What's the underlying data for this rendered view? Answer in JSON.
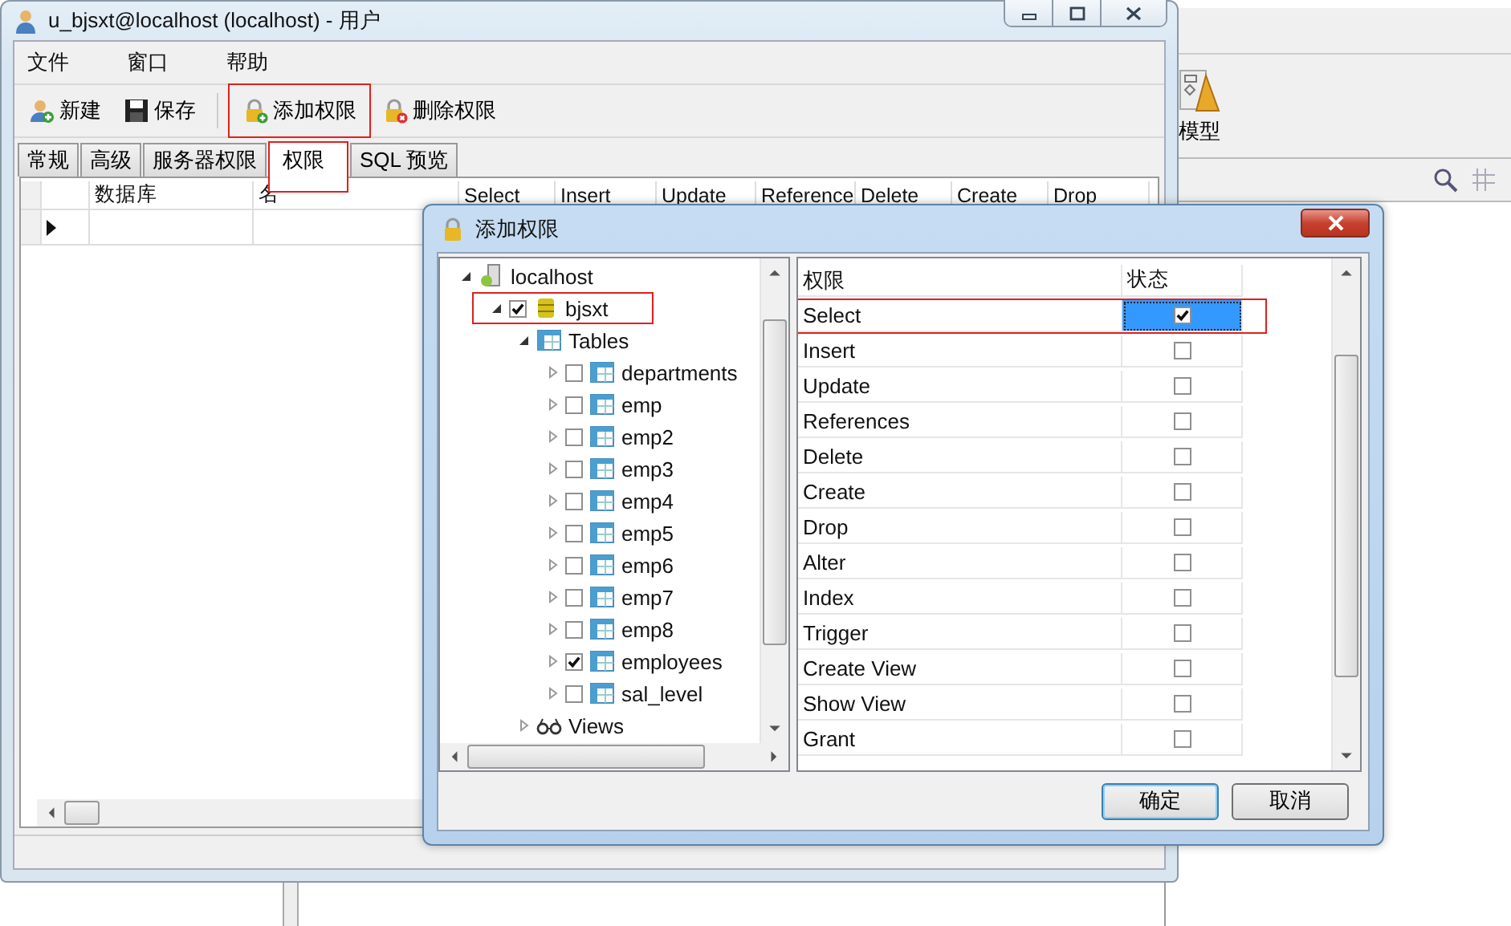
{
  "background_window": {
    "toolbar": [
      {
        "label": "模型",
        "kind": "model"
      }
    ]
  },
  "main_window": {
    "title": "u_bjsxt@localhost (localhost) - 用户",
    "menu": [
      "文件",
      "窗口",
      "帮助"
    ],
    "toolbar": [
      {
        "label": "新建",
        "kind": "new",
        "highlighted": false
      },
      {
        "label": "保存",
        "kind": "save",
        "highlighted": false
      },
      {
        "label": "添加权限",
        "kind": "add-lock",
        "highlighted": true
      },
      {
        "label": "删除权限",
        "kind": "remove-lock",
        "highlighted": false
      }
    ],
    "tabs": [
      {
        "label": "常规",
        "selected": false,
        "highlighted": false
      },
      {
        "label": "高级",
        "selected": false,
        "highlighted": false
      },
      {
        "label": "服务器权限",
        "selected": false,
        "highlighted": false
      },
      {
        "label": "权限",
        "selected": true,
        "highlighted": true
      },
      {
        "label": "SQL 预览",
        "selected": false,
        "highlighted": false
      }
    ],
    "grid": {
      "columns": [
        "数据库",
        "名",
        "Select",
        "Insert",
        "Update",
        "Reference",
        "Delete",
        "Create",
        "Drop"
      ],
      "rows": [
        {
          "current": true
        }
      ]
    }
  },
  "dialog": {
    "title": "添加权限",
    "tree": [
      {
        "label": "localhost",
        "kind": "server",
        "expanded": true,
        "children": [
          {
            "label": "bjsxt",
            "kind": "database",
            "expanded": true,
            "checked": true,
            "highlighted": true,
            "children": [
              {
                "label": "Tables",
                "kind": "folder",
                "expanded": true,
                "children": [
                  {
                    "label": "departments",
                    "kind": "table",
                    "expanded": false,
                    "checked": false
                  },
                  {
                    "label": "emp",
                    "kind": "table",
                    "expanded": false,
                    "checked": false
                  },
                  {
                    "label": "emp2",
                    "kind": "table",
                    "expanded": false,
                    "checked": false
                  },
                  {
                    "label": "emp3",
                    "kind": "table",
                    "expanded": false,
                    "checked": false
                  },
                  {
                    "label": "emp4",
                    "kind": "table",
                    "expanded": false,
                    "checked": false
                  },
                  {
                    "label": "emp5",
                    "kind": "table",
                    "expanded": false,
                    "checked": false
                  },
                  {
                    "label": "emp6",
                    "kind": "table",
                    "expanded": false,
                    "checked": false
                  },
                  {
                    "label": "emp7",
                    "kind": "table",
                    "expanded": false,
                    "checked": false
                  },
                  {
                    "label": "emp8",
                    "kind": "table",
                    "expanded": false,
                    "checked": false
                  },
                  {
                    "label": "employees",
                    "kind": "table",
                    "expanded": false,
                    "checked": true
                  },
                  {
                    "label": "sal_level",
                    "kind": "table",
                    "expanded": false,
                    "checked": false
                  }
                ]
              },
              {
                "label": "Views",
                "kind": "views",
                "expanded": false
              }
            ]
          }
        ]
      }
    ],
    "privileges": {
      "columns": [
        "权限",
        "状态"
      ],
      "rows": [
        {
          "label": "Select",
          "checked": true,
          "selected": true,
          "highlighted": true
        },
        {
          "label": "Insert",
          "checked": false,
          "selected": false,
          "highlighted": false
        },
        {
          "label": "Update",
          "checked": false,
          "selected": false,
          "highlighted": false
        },
        {
          "label": "References",
          "checked": false,
          "selected": false,
          "highlighted": false
        },
        {
          "label": "Delete",
          "checked": false,
          "selected": false,
          "highlighted": false
        },
        {
          "label": "Create",
          "checked": false,
          "selected": false,
          "highlighted": false
        },
        {
          "label": "Drop",
          "checked": false,
          "selected": false,
          "highlighted": false
        },
        {
          "label": "Alter",
          "checked": false,
          "selected": false,
          "highlighted": false
        },
        {
          "label": "Index",
          "checked": false,
          "selected": false,
          "highlighted": false
        },
        {
          "label": "Trigger",
          "checked": false,
          "selected": false,
          "highlighted": false
        },
        {
          "label": "Create View",
          "checked": false,
          "selected": false,
          "highlighted": false
        },
        {
          "label": "Show View",
          "checked": false,
          "selected": false,
          "highlighted": false
        },
        {
          "label": "Grant",
          "checked": false,
          "selected": false,
          "highlighted": false
        }
      ]
    },
    "buttons": [
      {
        "label": "确定",
        "default": true
      },
      {
        "label": "取消",
        "default": false
      }
    ]
  }
}
